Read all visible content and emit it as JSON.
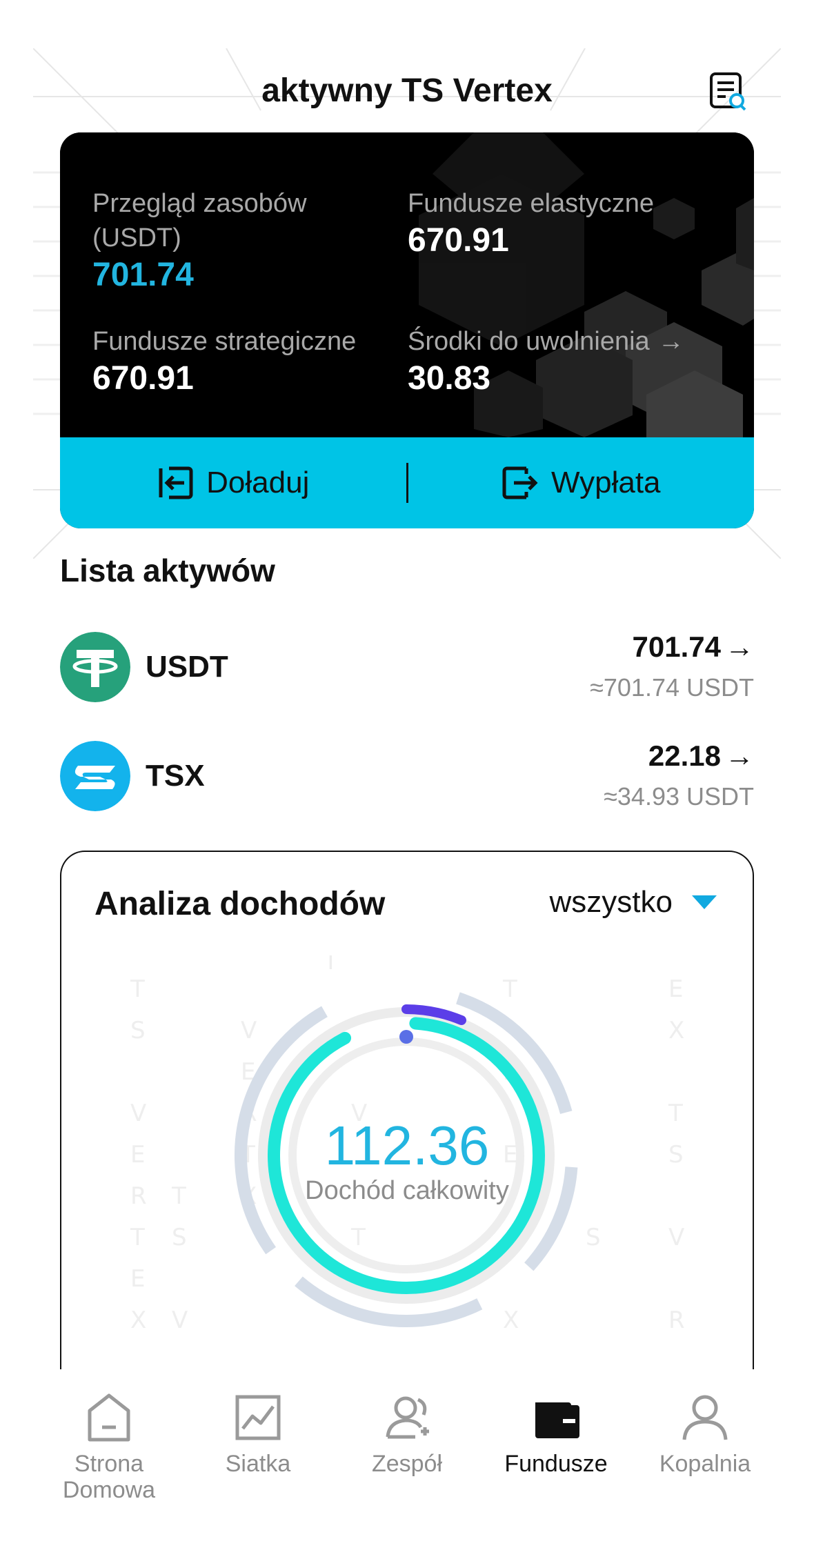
{
  "header": {
    "title": "aktywny TS Vertex",
    "record_icon": "document-search-icon"
  },
  "asset_card": {
    "overview_label": "Przegląd zasobów (USDT)",
    "overview_value": "701.74",
    "flexible_label": "Fundusze elastyczne",
    "flexible_value": "670.91",
    "strategic_label": "Fundusze strategiczne",
    "strategic_value": "670.91",
    "releasable_label": "Środki do uwolnienia",
    "releasable_value": "30.83",
    "deposit_label": "Doładuj",
    "withdraw_label": "Wypłata",
    "accent_color": "#22b5e0",
    "action_bar_color": "#00c4e6"
  },
  "assets": {
    "title": "Lista aktywów",
    "items": [
      {
        "name": "USDT",
        "amount": "701.74",
        "approx": "≈701.74 USDT",
        "icon": "tether-icon",
        "color": "#26a17b"
      },
      {
        "name": "TSX",
        "amount": "22.18",
        "approx": "≈34.93 USDT",
        "icon": "tsx-icon",
        "color": "#13b3ec"
      }
    ]
  },
  "income": {
    "title": "Analiza dochodów",
    "filter_value": "wszystko",
    "total_value": "112.36",
    "total_label": "Dochód całkowity"
  },
  "nav": {
    "items": [
      {
        "label": "Strona Domowa",
        "icon": "home-icon",
        "active": false
      },
      {
        "label": "Siatka",
        "icon": "chart-icon",
        "active": false
      },
      {
        "label": "Zespół",
        "icon": "team-icon",
        "active": false
      },
      {
        "label": "Fundusze",
        "icon": "wallet-icon",
        "active": true
      },
      {
        "label": "Kopalnia",
        "icon": "user-icon",
        "active": false
      }
    ]
  }
}
